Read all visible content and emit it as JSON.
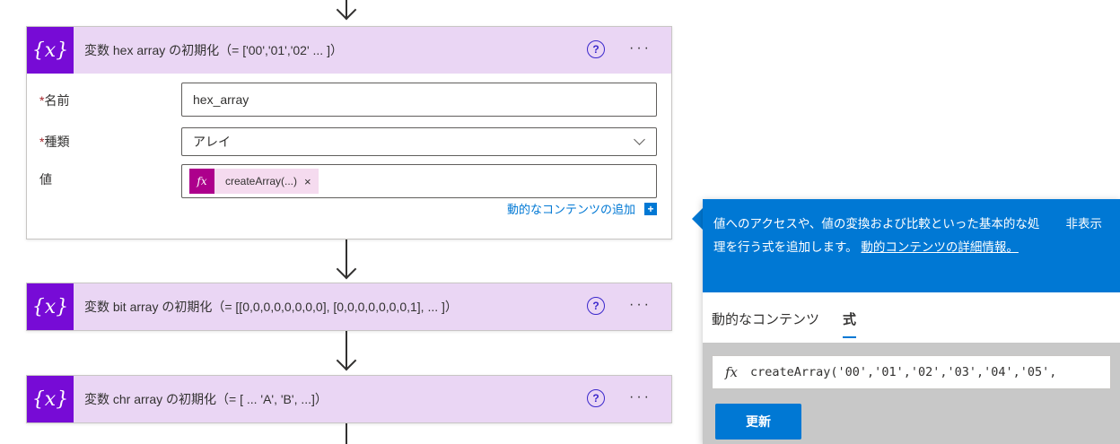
{
  "cards": [
    {
      "title": "変数 hex array の初期化（= ['00','01','02' ... ]）",
      "help": "?",
      "more": "···",
      "fields": {
        "name_label": "名前",
        "name_value": "hex_array",
        "type_label": "種類",
        "type_value": "アレイ",
        "value_label": "値",
        "token_fx": "fx",
        "token_text": "createArray(...)",
        "token_remove": "×",
        "add_dynamic_label": "動的なコンテンツの追加",
        "required_mark": "*"
      }
    },
    {
      "title": "変数 bit array の初期化（= [[0,0,0,0,0,0,0,0], [0,0,0,0,0,0,0,1], ... ]）",
      "help": "?",
      "more": "···"
    },
    {
      "title": "変数 chr array の初期化（= [ ... 'A', 'B', ...]）",
      "help": "?",
      "more": "···"
    }
  ],
  "panel": {
    "description": "値へのアクセスや、値の変換および比較といった基本的な処理を行う式を追加します。",
    "link": "動的コンテンツの詳細情報。",
    "hide": "非表示",
    "tabs": [
      {
        "label": "動的なコンテンツ",
        "active": false
      },
      {
        "label": "式",
        "active": true
      }
    ],
    "expression_fx": "fx",
    "expression": "createArray('00','01','02','03','04','05',",
    "update": "更新"
  },
  "colors": {
    "variable_icon_bg": "#770bd6",
    "card_header_bg": "#ead6f4",
    "token_fx_bg": "#ad008c",
    "token_bg": "#f5dbef",
    "accent_blue": "#0078d4",
    "help_icon": "#3b28cc",
    "required": "#a4262c"
  },
  "icons": {
    "variable": "curly-braces-x-icon",
    "help": "question-circle-icon",
    "more": "ellipsis-icon",
    "chevron": "chevron-down-icon",
    "add": "plus-square-icon",
    "flow_arrow": "arrow-down-icon"
  }
}
